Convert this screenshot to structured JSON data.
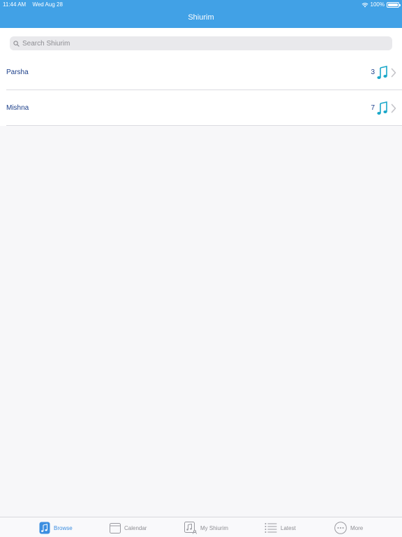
{
  "status_bar": {
    "time": "11:44 AM",
    "date": "Wed Aug 28",
    "battery": "100%"
  },
  "nav": {
    "title": "Shiurim"
  },
  "search": {
    "placeholder": "Search Shiurim",
    "value": ""
  },
  "rows": [
    {
      "label": "Parsha",
      "count": "3",
      "icon": "music-note-icon"
    },
    {
      "label": "Mishna",
      "count": "7",
      "icon": "music-note-icon"
    }
  ],
  "tabs": [
    {
      "label": "Browse",
      "icon": "music-note-icon",
      "active": true
    },
    {
      "label": "Calendar",
      "icon": "calendar-icon",
      "active": false
    },
    {
      "label": "My Shiurim",
      "icon": "my-shiurim-icon",
      "active": false
    },
    {
      "label": "Latest",
      "icon": "list-icon",
      "active": false
    },
    {
      "label": "More",
      "icon": "more-icon",
      "active": false
    }
  ],
  "colors": {
    "nav_bar": "#41a1e6",
    "accent": "#3c8ee0",
    "row_text": "#1c3f8a",
    "music_icon": "#19a7c9"
  }
}
